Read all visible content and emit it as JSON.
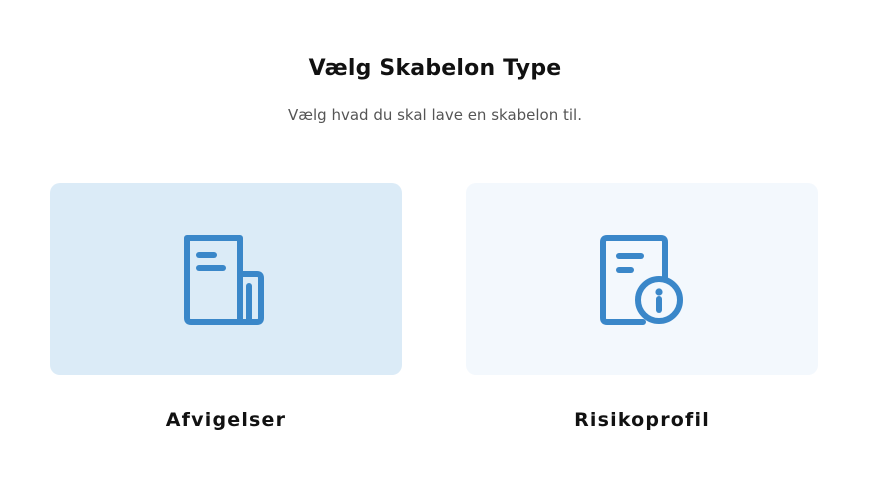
{
  "header": {
    "title": "Vælg Skabelon Type",
    "subtitle": "Vælg hvad du skal lave en skabelon til."
  },
  "options": [
    {
      "label": "Afvigelser",
      "icon": "newspaper-icon",
      "selected": true
    },
    {
      "label": "Risikoprofil",
      "icon": "document-info-icon",
      "selected": false
    }
  ],
  "colors": {
    "icon": "#3a87c9",
    "selected_card": "#dbebf7",
    "card": "#f3f8fd"
  }
}
